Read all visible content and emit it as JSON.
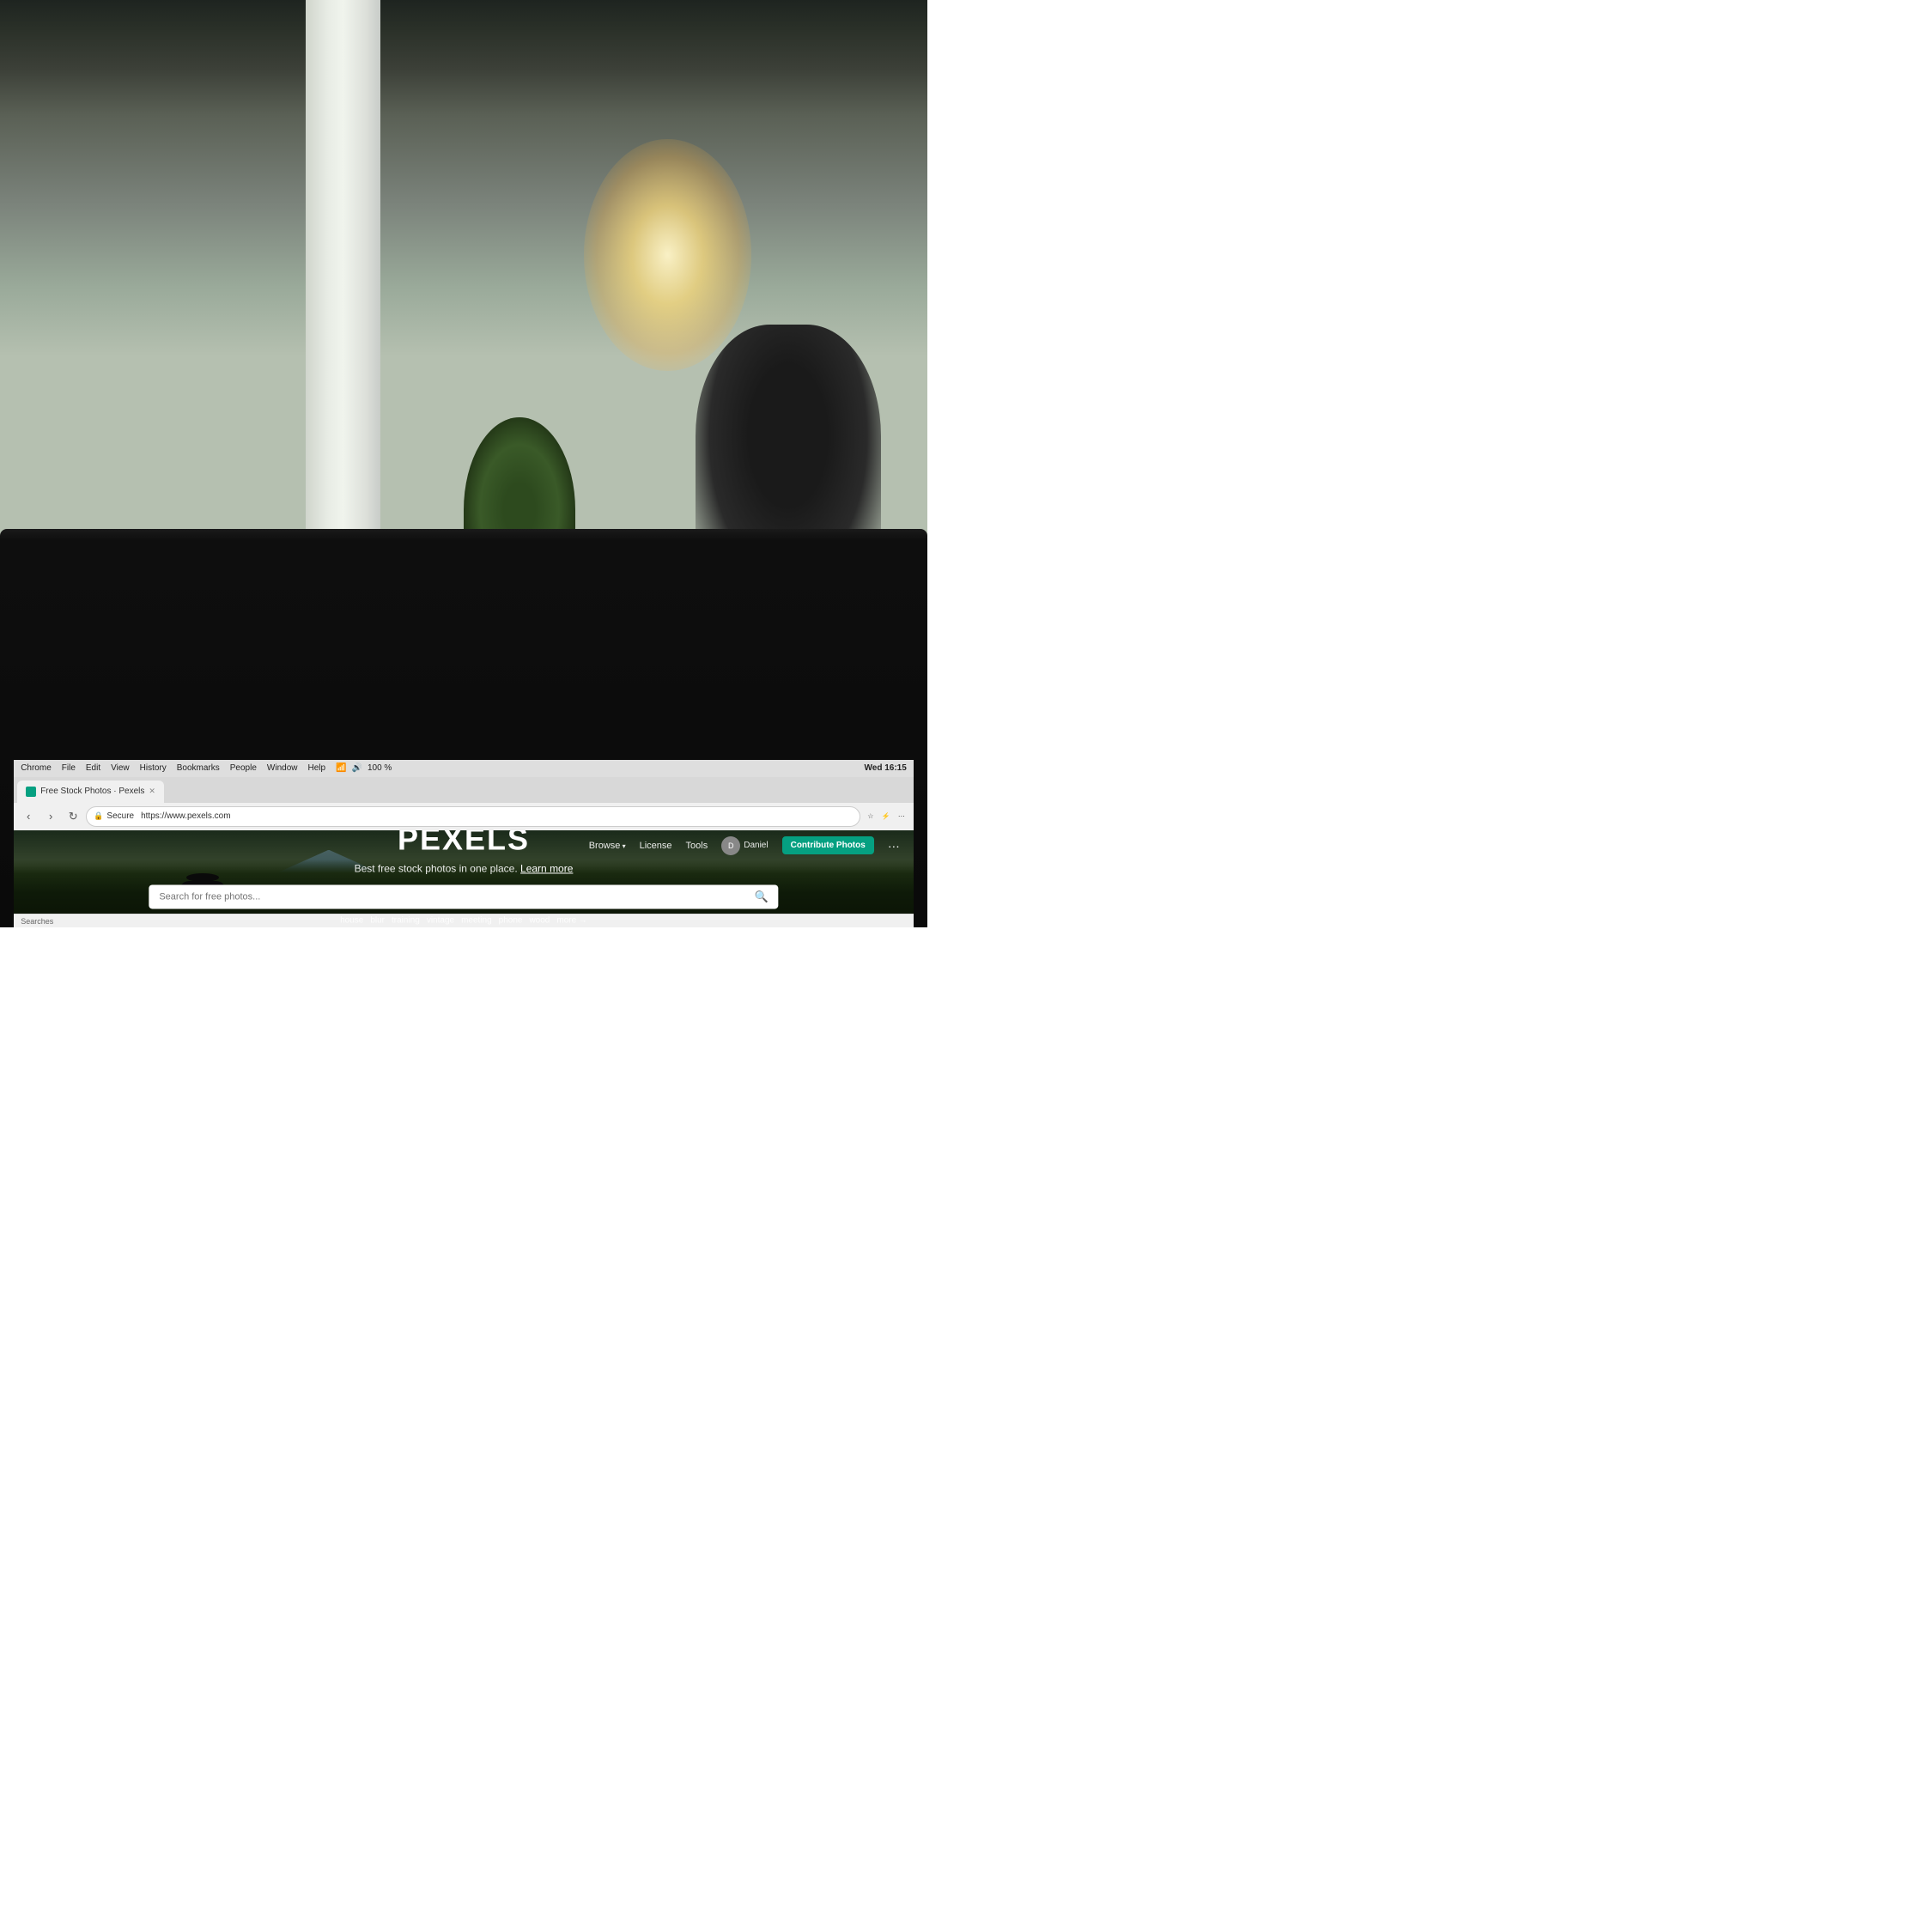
{
  "background": {
    "description": "Office space with bokeh background"
  },
  "screen": {
    "frame_color": "#0a0a0a"
  },
  "browser": {
    "tab": {
      "favicon_color": "#05a081",
      "title": "Free Stock Photos · Pexels"
    },
    "menubar": {
      "items": [
        "Chrome",
        "File",
        "Edit",
        "View",
        "History",
        "Bookmarks",
        "People",
        "Window",
        "Help"
      ]
    },
    "address": {
      "secure_label": "Secure",
      "url": "https://www.pexels.com"
    },
    "system_time": "Wed 16:15",
    "battery_pct": "100 %",
    "tab_close": "✕"
  },
  "website": {
    "nav": {
      "browse_label": "Browse",
      "license_label": "License",
      "tools_label": "Tools",
      "user_name": "Daniel",
      "contribute_label": "Contribute Photos",
      "more_icon": "···"
    },
    "hero": {
      "logo": "PEXELS",
      "tagline": "Best free stock photos in one place.",
      "learn_more": "Learn more",
      "search_placeholder": "Search for free photos...",
      "suggestions": [
        "house",
        "blur",
        "training",
        "vintage",
        "meeting",
        "phone",
        "wood"
      ],
      "more_label": "more →"
    }
  },
  "statusbar": {
    "searches_label": "Searches"
  }
}
